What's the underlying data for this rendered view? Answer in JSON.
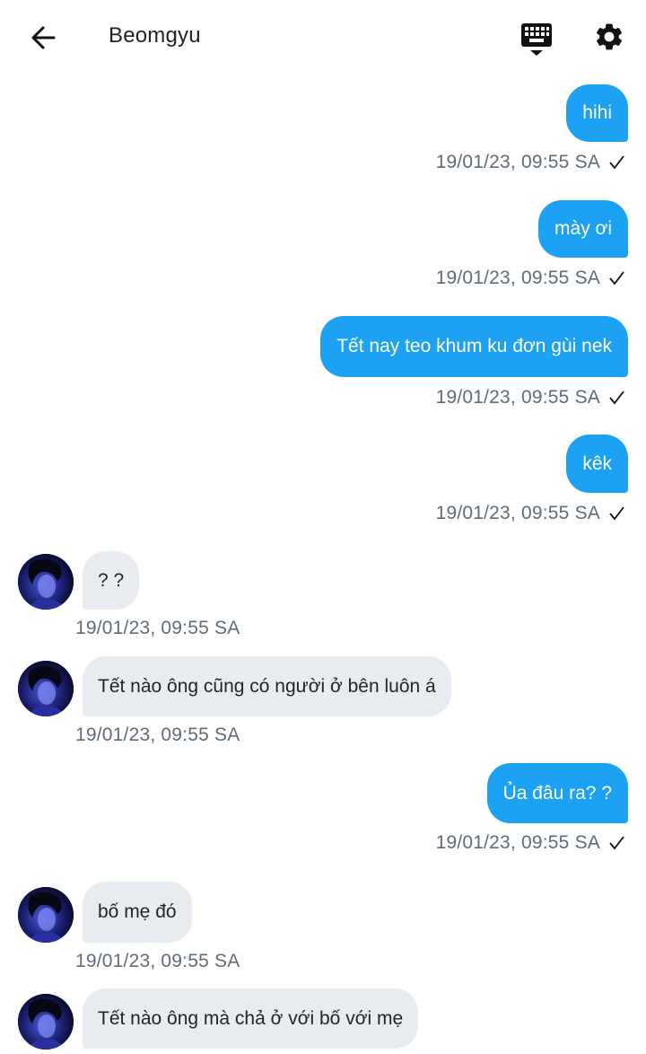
{
  "header": {
    "title": "Beomgyu"
  },
  "messages": [
    {
      "dir": "out",
      "text": "hihi",
      "time": "19/01/23,  09:55 SA"
    },
    {
      "dir": "out",
      "text": "mày ơi",
      "time": "19/01/23,  09:55 SA"
    },
    {
      "dir": "out",
      "text": "Tết nay teo khum ku đơn gùi nek",
      "time": "19/01/23,  09:55 SA"
    },
    {
      "dir": "out",
      "text": "kêk",
      "time": "19/01/23,  09:55 SA"
    },
    {
      "dir": "in",
      "text": "? ?",
      "time": "19/01/23,  09:55 SA"
    },
    {
      "dir": "in",
      "text": "Tết nào ông cũng có người ở bên luôn á",
      "time": "19/01/23,  09:55 SA"
    },
    {
      "dir": "out",
      "text": "Ủa đâu ra? ?",
      "time": "19/01/23,  09:55 SA"
    },
    {
      "dir": "in",
      "text": "bố mẹ đó",
      "time": "19/01/23,  09:55 SA"
    },
    {
      "dir": "in",
      "text": "Tết nào ông mà chả ở với bố với mẹ",
      "time": ""
    }
  ],
  "colors": {
    "outgoing_bubble": "#1da1f2",
    "incoming_bubble": "#e8ebef",
    "timestamp": "#5f6b78"
  },
  "icons": [
    "back-arrow-icon",
    "keyboard-icon",
    "gear-icon",
    "check-icon",
    "avatar"
  ]
}
